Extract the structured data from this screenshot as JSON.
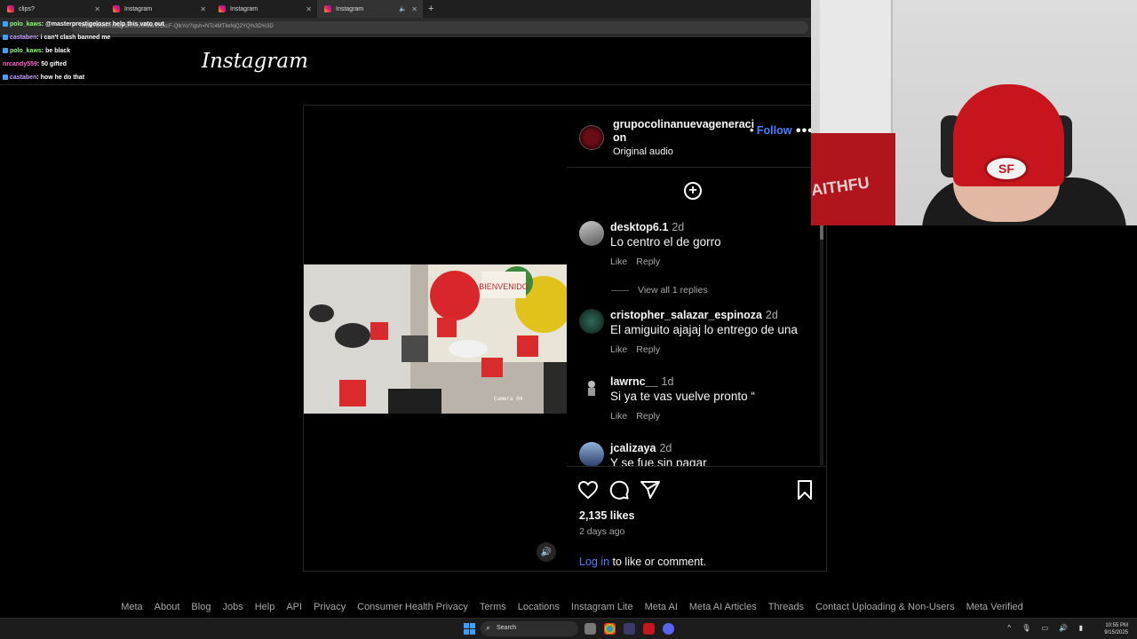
{
  "browser": {
    "tabs": [
      {
        "label": "clips?",
        "active": false
      },
      {
        "label": "Instagram",
        "active": false
      },
      {
        "label": "Instagram",
        "active": false
      },
      {
        "label": "Instagram",
        "active": true
      }
    ],
    "url": "https://www.instagram.com/reel/DOkcF-QlkYo/?igsh=NTc4MTIwNjQ2YQ%3D%3D"
  },
  "chat": [
    {
      "user": "polo_kaws",
      "message": "@masterprestigeloser help this vato out"
    },
    {
      "user": "castaben",
      "message": "i can't clash banned me"
    },
    {
      "user": "polo_kaws",
      "message": "be black"
    },
    {
      "user": "nrcandy559",
      "message": "50 gifted"
    },
    {
      "user": "castaben",
      "message": "how he do that"
    }
  ],
  "instagram": {
    "logo": "Instagram",
    "video": {
      "overlay_text": "Camera 04"
    },
    "post": {
      "author": "grupocolinanuevageneraci on",
      "follow_label": "Follow",
      "audio": "Original audio",
      "more_label": "•••"
    },
    "comments": [
      {
        "user": "desktop6.1",
        "time": "2d",
        "text": "Lo centro el de gorro",
        "like": "Like",
        "reply": "Reply"
      },
      {
        "user": "cristopher_salazar_espinoza",
        "time": "2d",
        "text": "El amiguito ajajaj lo entrego de una",
        "like": "Like",
        "reply": "Reply"
      },
      {
        "user": "lawrnc__",
        "time": "1d",
        "text": "Si ya te vas vuelve pronto “",
        "like": "Like",
        "reply": "Reply"
      },
      {
        "user": "jcalizaya",
        "time": "2d",
        "text": "Y se fue sin pagar",
        "like": "Like",
        "reply": "Reply"
      }
    ],
    "view_replies": "View all 1 replies",
    "likes": "2,135 likes",
    "posted": "2 days ago",
    "login_link": "Log in",
    "login_rest": " to like or comment.",
    "footer": [
      "Meta",
      "About",
      "Blog",
      "Jobs",
      "Help",
      "API",
      "Privacy",
      "Consumer Health Privacy",
      "Terms",
      "Locations",
      "Instagram Lite",
      "Meta AI",
      "Meta AI Articles",
      "Threads",
      "Contact Uploading & Non-Users",
      "Meta Verified"
    ]
  },
  "webcam": {
    "flag_text": "AITHFU"
  },
  "taskbar": {
    "search": "Search",
    "time": "10:55 PM",
    "date": "9/15/2025"
  },
  "colors": {
    "link": "#4a7dff",
    "background": "#000000",
    "muted": "#a8a8a8"
  }
}
